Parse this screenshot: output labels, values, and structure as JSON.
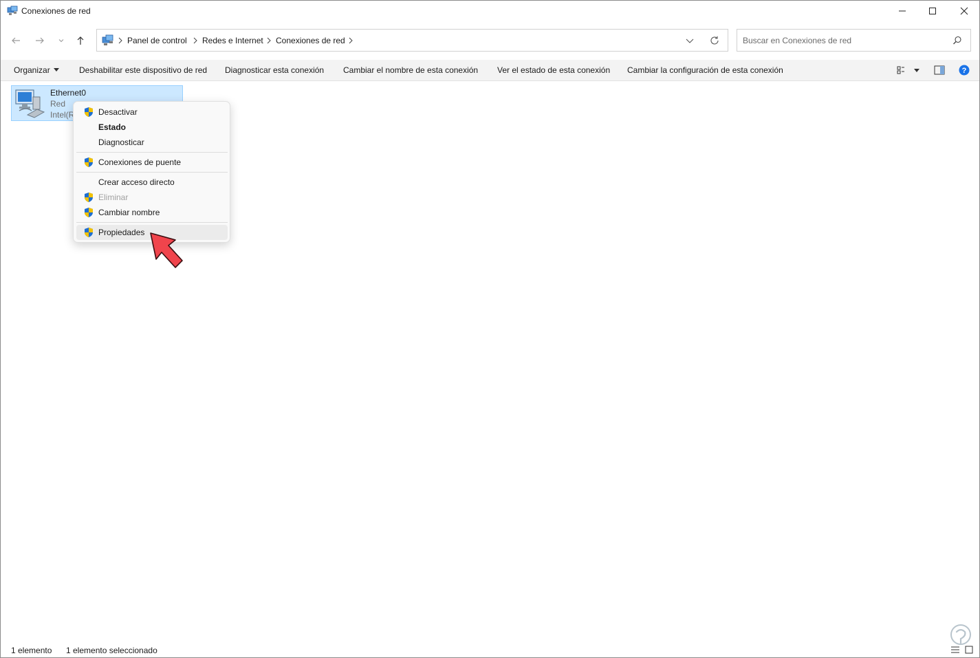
{
  "window": {
    "title": "Conexiones de red"
  },
  "nav": {
    "breadcrumb": [
      "Panel de control",
      "Redes e Internet",
      "Conexiones de red"
    ],
    "search_placeholder": "Buscar en Conexiones de red"
  },
  "commandbar": {
    "organize": "Organizar",
    "commands": [
      "Deshabilitar este dispositivo de red",
      "Diagnosticar esta conexión",
      "Cambiar el nombre de esta conexión",
      "Ver el estado de esta conexión",
      "Cambiar la configuración de esta conexión"
    ]
  },
  "item": {
    "name": "Ethernet0",
    "network": "Red",
    "adapter": "Intel(R"
  },
  "context_menu": {
    "items": [
      {
        "label": "Desactivar",
        "icon": "uac-shield-icon",
        "bold": false,
        "disabled": false
      },
      {
        "label": "Estado",
        "icon": "",
        "bold": true,
        "disabled": false
      },
      {
        "label": "Diagnosticar",
        "icon": "",
        "bold": false,
        "disabled": false
      },
      {
        "label": "Conexiones de puente",
        "icon": "uac-shield-icon",
        "bold": false,
        "disabled": false
      },
      {
        "label": "Crear acceso directo",
        "icon": "",
        "bold": false,
        "disabled": false
      },
      {
        "label": "Eliminar",
        "icon": "uac-shield-icon",
        "bold": false,
        "disabled": true
      },
      {
        "label": "Cambiar nombre",
        "icon": "uac-shield-icon",
        "bold": false,
        "disabled": false
      },
      {
        "label": "Propiedades",
        "icon": "uac-shield-icon",
        "bold": false,
        "disabled": false,
        "highlighted": true
      }
    ]
  },
  "status": {
    "count": "1 elemento",
    "selected": "1 elemento seleccionado"
  },
  "colors": {
    "selection_bg": "#cce8ff",
    "selection_border": "#99d1ff",
    "arrow": "#f0444c",
    "help": "#1a73e8"
  }
}
